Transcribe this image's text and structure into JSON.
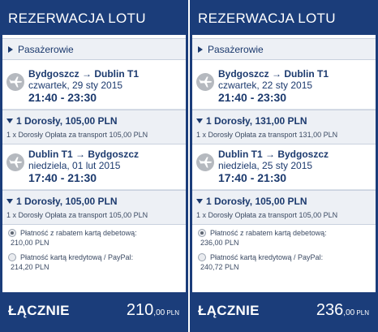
{
  "panels": [
    {
      "title": "REZERWACJA LOTU",
      "passengers_label": "Pasażerowie",
      "flights": [
        {
          "route": "Bydgoszcz → Dublin T1",
          "date": "czwartek, 29 sty 2015",
          "time": "21:40 - 23:30",
          "fare_title": "1 Dorosły, 105,00 PLN",
          "fare_detail": "1 x Dorosły Opłata za transport 105,00 PLN"
        },
        {
          "route": "Dublin T1 → Bydgoszcz",
          "date": "niedziela, 01 lut 2015",
          "time": "17:40 - 21:30",
          "fare_title": "1 Dorosły, 105,00 PLN",
          "fare_detail": "1 x Dorosły Opłata za transport 105,00 PLN"
        }
      ],
      "payment": [
        {
          "label": "Płatność z rabatem kartą debetową:",
          "amount": "210,00 PLN",
          "selected": true
        },
        {
          "label": "Płatność kartą kredytową / PayPal:",
          "amount": "214,20 PLN",
          "selected": false
        }
      ],
      "total_label": "ŁĄCZNIE",
      "total_int": "210",
      "total_dec": ",00",
      "total_cur": " PLN"
    },
    {
      "title": "REZERWACJA LOTU",
      "passengers_label": "Pasażerowie",
      "flights": [
        {
          "route": "Bydgoszcz → Dublin T1",
          "date": "czwartek, 22 sty 2015",
          "time": "21:40 - 23:30",
          "fare_title": "1 Dorosły, 131,00 PLN",
          "fare_detail": "1 x Dorosły Opłata za transport 131,00 PLN"
        },
        {
          "route": "Dublin T1 → Bydgoszcz",
          "date": "niedziela, 25 sty 2015",
          "time": "17:40 - 21:30",
          "fare_title": "1 Dorosły, 105,00 PLN",
          "fare_detail": "1 x Dorosły Opłata za transport 105,00 PLN"
        }
      ],
      "payment": [
        {
          "label": "Płatność z rabatem kartą debetową:",
          "amount": "236,00 PLN",
          "selected": true
        },
        {
          "label": "Płatność kartą kredytową / PayPal:",
          "amount": "240,72 PLN",
          "selected": false
        }
      ],
      "total_label": "ŁĄCZNIE",
      "total_int": "236",
      "total_dec": ",00",
      "total_cur": " PLN"
    }
  ],
  "icons": {
    "plane": "plane-icon",
    "expand": "triangle-right-icon",
    "collapse": "triangle-down-icon"
  },
  "colors": {
    "brand": "#1b3d7a",
    "panel_bg": "#edf0f5",
    "text": "#1c3a6e"
  }
}
